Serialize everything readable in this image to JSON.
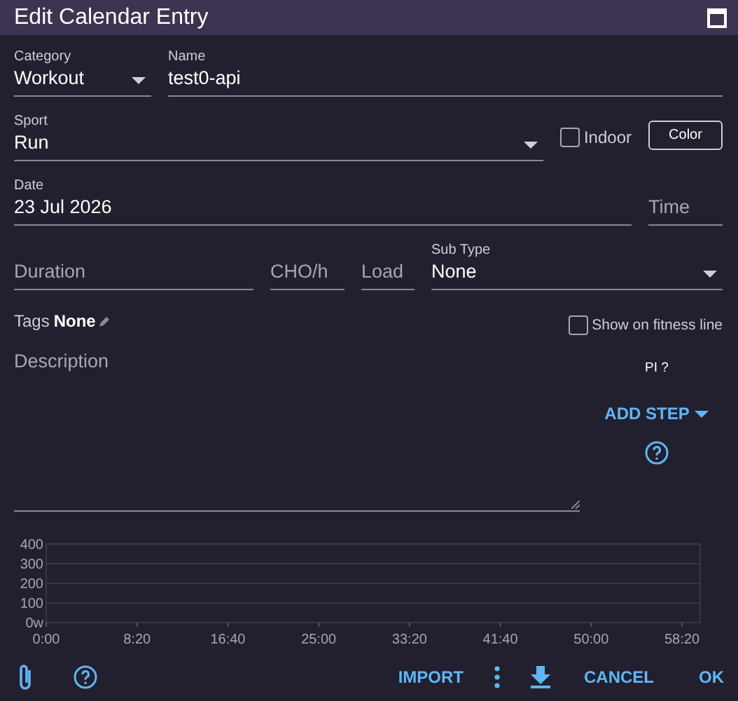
{
  "window": {
    "title": "Edit Calendar Entry"
  },
  "category": {
    "label": "Category",
    "value": "Workout"
  },
  "name": {
    "label": "Name",
    "value": "test0-api"
  },
  "sport": {
    "label": "Sport",
    "value": "Run"
  },
  "indoor": {
    "label": "Indoor",
    "checked": false
  },
  "color_button": "Color",
  "date": {
    "label": "Date",
    "value": "23 Jul 2026"
  },
  "time": {
    "placeholder": "Time"
  },
  "duration": {
    "placeholder": "Duration"
  },
  "cho": {
    "placeholder": "CHO/h"
  },
  "load": {
    "placeholder": "Load"
  },
  "sub_type": {
    "label": "Sub Type",
    "value": "None"
  },
  "tags": {
    "label": "Tags",
    "value": "None"
  },
  "fitness_line": {
    "label": "Show on fitness line",
    "checked": false
  },
  "description": {
    "placeholder": "Description"
  },
  "pi": "PI ?",
  "add_step": "ADD STEP",
  "chart": {
    "chart_data": {
      "type": "line",
      "grid": true,
      "xlim": [
        0,
        3600
      ],
      "ylim": [
        0,
        400
      ],
      "xticks": [
        {
          "value": 0,
          "label": "0:00"
        },
        {
          "value": 500,
          "label": "8:20"
        },
        {
          "value": 1000,
          "label": "16:40"
        },
        {
          "value": 1500,
          "label": "25:00"
        },
        {
          "value": 2000,
          "label": "33:20"
        },
        {
          "value": 2500,
          "label": "41:40"
        },
        {
          "value": 3000,
          "label": "50:00"
        },
        {
          "value": 3500,
          "label": "58:20"
        }
      ],
      "yticks": [
        {
          "value": 0,
          "label": "0w"
        },
        {
          "value": 100,
          "label": "100"
        },
        {
          "value": 200,
          "label": "200"
        },
        {
          "value": 300,
          "label": "300"
        },
        {
          "value": 400,
          "label": "400"
        }
      ]
    }
  },
  "footer": {
    "import": "IMPORT",
    "cancel": "CANCEL",
    "ok": "OK"
  }
}
